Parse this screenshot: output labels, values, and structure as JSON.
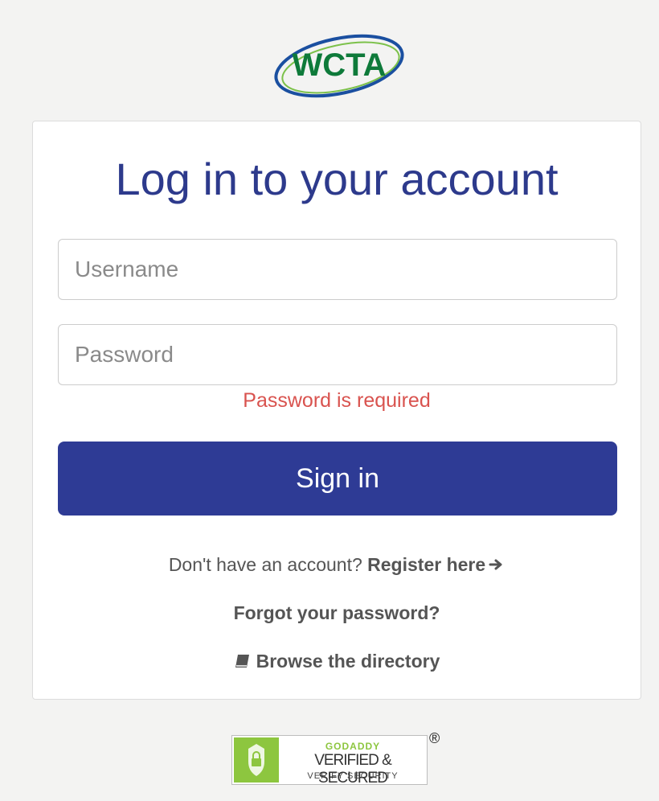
{
  "logo": {
    "text": "WCTA"
  },
  "login": {
    "title": "Log in to your account",
    "username_placeholder": "Username",
    "username_value": "",
    "password_placeholder": "Password",
    "password_value": "",
    "error_message": "Password is required",
    "signin_label": "Sign in"
  },
  "links": {
    "register_prompt": "Don't have an account?",
    "register_label": "Register here",
    "forgot_label": "Forgot your password?",
    "browse_label": "Browse the directory"
  },
  "badge": {
    "line1": "GODADDY",
    "line2": "VERIFIED & SECURED",
    "line3": "VERIFY SECURITY",
    "registered": "®"
  },
  "colors": {
    "primary": "#2e3b95",
    "title": "#2d3a8c",
    "error": "#d9534f",
    "logo_green": "#0e7a3a",
    "badge_green": "#8dc63f"
  }
}
